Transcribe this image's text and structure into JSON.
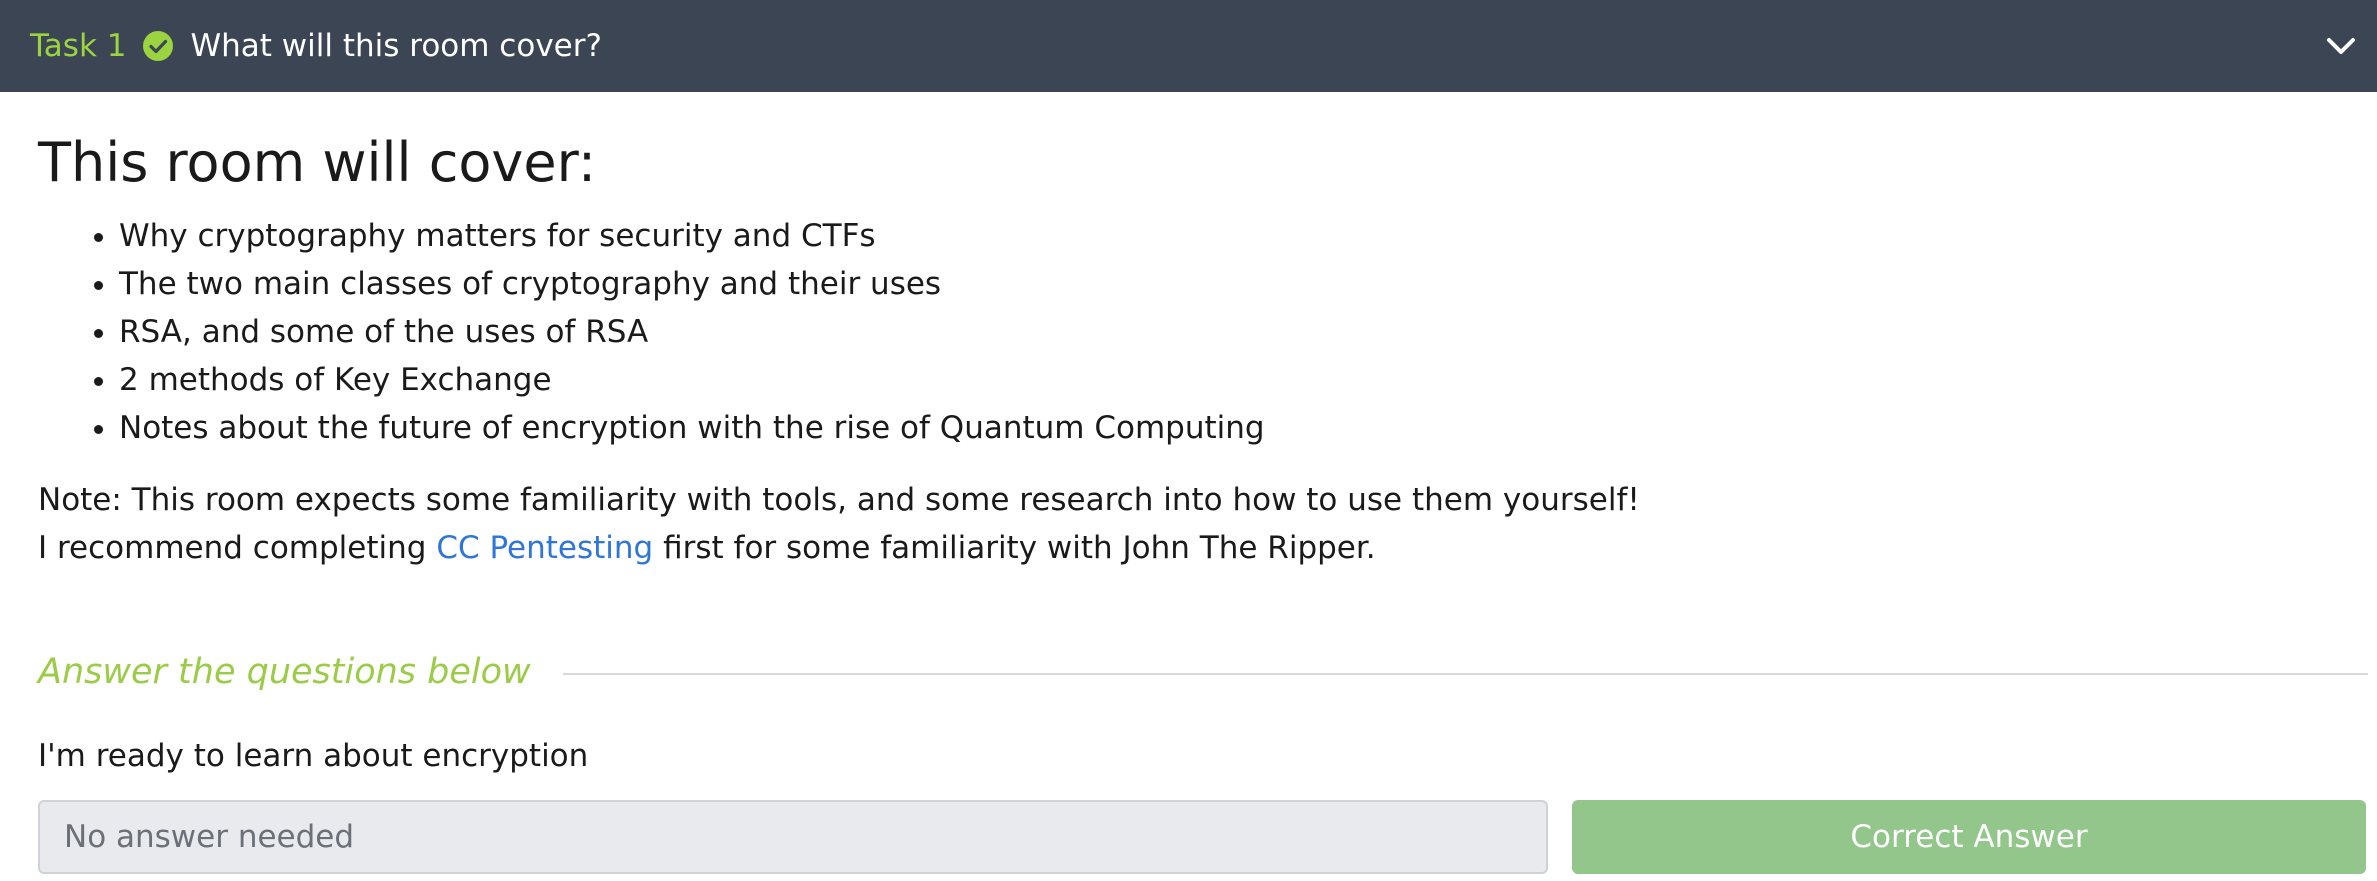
{
  "header": {
    "task_label": "Task 1",
    "title": "What will this room cover?",
    "status_color": "#9bd341"
  },
  "main": {
    "heading": "This room will cover:",
    "topics": [
      "Why cryptography matters for security and CTFs",
      "The two main classes of cryptography and their uses",
      "RSA, and some of the uses of RSA",
      "2 methods of Key Exchange",
      "Notes about the future of encryption with the rise of Quantum Computing"
    ],
    "note_line1": "Note: This room expects some familiarity with tools, and some research into how to use them yourself!",
    "note_line2_before": "I recommend completing ",
    "note_link": "CC Pentesting",
    "note_line2_after": " first for some familiarity with John The Ripper."
  },
  "answers": {
    "heading": "Answer the questions below",
    "question": "I'm ready to learn about encryption",
    "input_placeholder": "No answer needed",
    "submit_label": "Correct Answer",
    "accent_color": "#9bcc47",
    "button_color": "#92c68b"
  }
}
